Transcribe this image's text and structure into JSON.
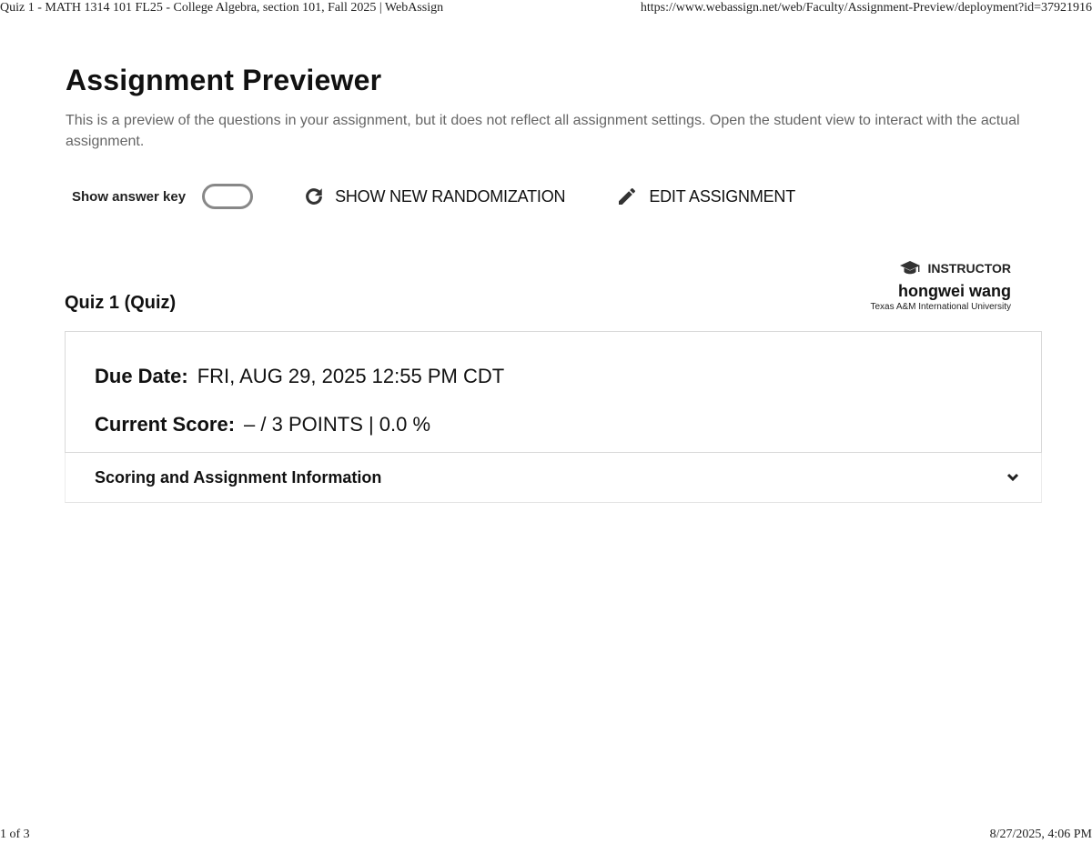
{
  "print_header": {
    "title": "Quiz 1 - MATH 1314 101 FL25 - College Algebra, section 101, Fall 2025 | WebAssign",
    "url": "https://www.webassign.net/web/Faculty/Assignment-Preview/deployment?id=37921916"
  },
  "page": {
    "title": "Assignment Previewer",
    "intro": "This is a preview of the questions in your assignment, but it does not reflect all assignment settings. Open the student view to interact with the actual assignment."
  },
  "toolbar": {
    "answer_key_label": "Show answer key",
    "answer_key_on": false,
    "randomize_label": "SHOW NEW RANDOMIZATION",
    "edit_label": "EDIT ASSIGNMENT",
    "randomize_icon": "refresh-icon",
    "edit_icon": "pencil-icon"
  },
  "assignment": {
    "title": "Quiz 1 (Quiz)",
    "due_label": "Due Date:",
    "due_value": "FRI, AUG 29, 2025 12:55 PM CDT",
    "score_label": "Current Score:",
    "score_value": "– / 3 POINTS | 0.0 %"
  },
  "instructor": {
    "role": "INSTRUCTOR",
    "role_icon": "graduation-cap-icon",
    "name": "hongwei wang",
    "school": "Texas A&M International University"
  },
  "accordion": {
    "label": "Scoring and Assignment Information",
    "icon": "chevron-down-icon"
  },
  "print_footer": {
    "page": "1 of 3",
    "datetime": "8/27/2025, 4:06 PM"
  }
}
